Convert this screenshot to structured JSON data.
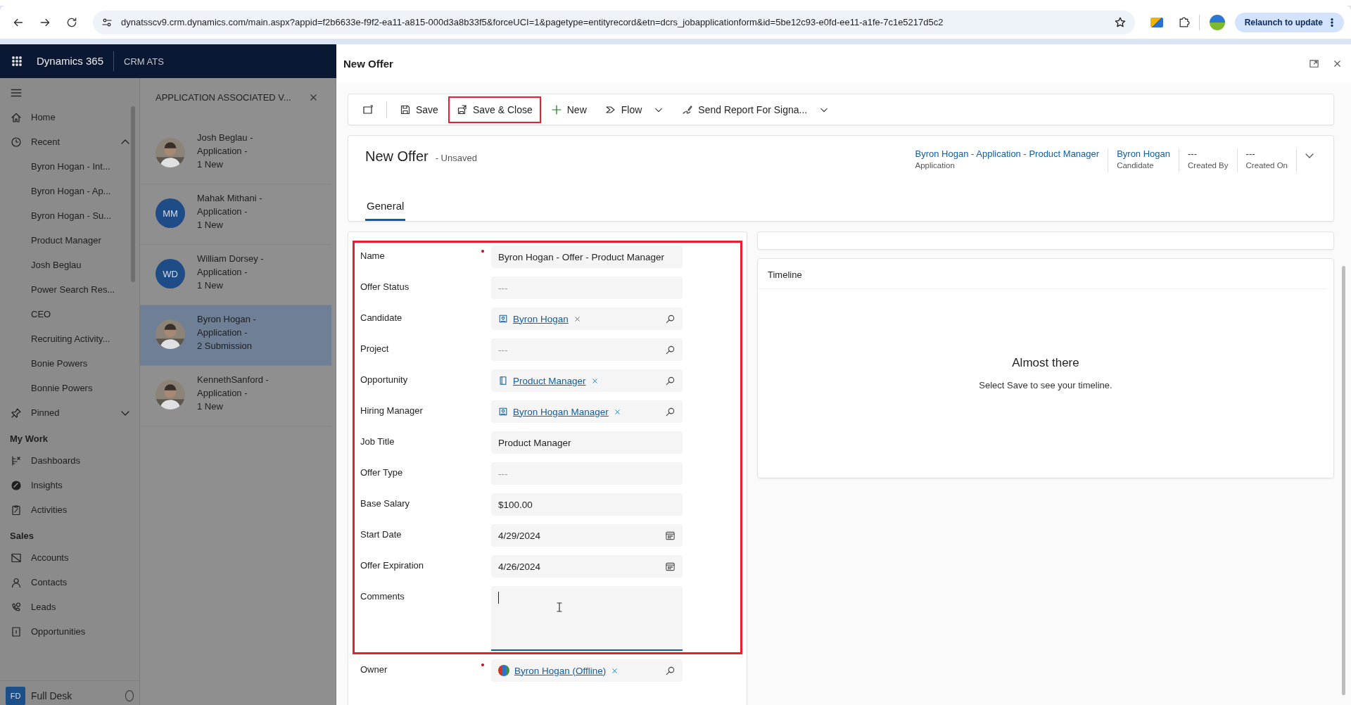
{
  "browser": {
    "url": "dynatsscv9.crm.dynamics.com/main.aspx?appid=f2b6633e-f9f2-ea11-a815-000d3a8b33f5&forceUCI=1&pagetype=entityrecord&etn=dcrs_jobapplicationform&id=5be12c93-e0fd-ee11-a1fe-7c1e5217d5c2",
    "update_button": "Relaunch to update"
  },
  "app": {
    "name": "Dynamics 365",
    "area": "CRM ATS"
  },
  "sidebar": {
    "home": {
      "label": "Home"
    },
    "recent": {
      "label": "Recent",
      "expanded": true,
      "items": [
        "Byron Hogan - Int...",
        "Byron Hogan - Ap...",
        "Byron Hogan - Su...",
        "Product Manager",
        "Josh Beglau",
        "Power Search Res...",
        "CEO",
        "Recruiting Activity...",
        "Bonie Powers",
        "Bonnie Powers"
      ]
    },
    "pinned": {
      "label": "Pinned",
      "expanded": false
    },
    "sections": [
      {
        "title": "My Work",
        "items": [
          "Dashboards",
          "Insights",
          "Activities"
        ]
      },
      {
        "title": "Sales",
        "items": [
          "Accounts",
          "Contacts",
          "Leads",
          "Opportunities"
        ]
      }
    ],
    "footer": {
      "initials": "FD",
      "label": "Full Desk"
    }
  },
  "records": {
    "title": "APPLICATION ASSOCIATED V...",
    "items": [
      {
        "lines": [
          "Josh Beglau -",
          "Application -",
          "1 New"
        ],
        "avatar": {
          "kind": "picture"
        },
        "selected": false
      },
      {
        "lines": [
          "Mahak Mithani -",
          "Application -",
          "1 New"
        ],
        "avatar": {
          "kind": "initials",
          "initials": "MM"
        },
        "selected": false
      },
      {
        "lines": [
          "William Dorsey -",
          "Application -",
          "1 New"
        ],
        "avatar": {
          "kind": "initials",
          "initials": "WD"
        },
        "selected": false
      },
      {
        "lines": [
          "Byron Hogan -",
          "Application -",
          "2 Submission"
        ],
        "avatar": {
          "kind": "picture"
        },
        "selected": true
      },
      {
        "lines": [
          "KennethSanford -",
          "Application -",
          "1 New"
        ],
        "avatar": {
          "kind": "picture"
        },
        "selected": false
      }
    ]
  },
  "dialog": {
    "title": "New Offer",
    "toolbar": [
      {
        "kind": "icon",
        "highlighted": false
      },
      {
        "kind": "button",
        "label": "Save",
        "highlighted": false,
        "dropdown": false
      },
      {
        "kind": "button",
        "label": "Save & Close",
        "highlighted": true,
        "dropdown": false
      },
      {
        "kind": "button",
        "label": "New",
        "highlighted": false,
        "dropdown": false
      },
      {
        "kind": "button",
        "label": "Flow",
        "highlighted": false,
        "dropdown": true
      },
      {
        "kind": "button",
        "label": "Send Report For Signa...",
        "highlighted": false,
        "dropdown": true
      }
    ],
    "header": {
      "title": "New Offer",
      "status": "- Unsaved",
      "fields": [
        {
          "value": "Byron Hogan - Application - Product Manager",
          "label": "Application",
          "link": true
        },
        {
          "value": "Byron Hogan",
          "label": "Candidate",
          "link": true
        },
        {
          "value": "---",
          "label": "Created By",
          "link": false
        },
        {
          "value": "---",
          "label": "Created On",
          "link": false
        }
      ]
    },
    "tabs": [
      {
        "label": "General",
        "selected": true
      }
    ],
    "form": {
      "sections": [
        {
          "highlighted": true,
          "fields": [
            {
              "label": "Name",
              "required": true,
              "kind": "text",
              "value": "Byron Hogan - Offer - Product Manager"
            },
            {
              "label": "Offer Status",
              "required": false,
              "kind": "option",
              "placeholder": "---"
            },
            {
              "label": "Candidate",
              "required": false,
              "kind": "lookup",
              "value": "Byron Hogan"
            },
            {
              "label": "Project",
              "required": false,
              "kind": "lookup",
              "placeholder": "---"
            },
            {
              "label": "Opportunity",
              "required": false,
              "kind": "lookup",
              "value": "Product Manager"
            },
            {
              "label": "Hiring Manager",
              "required": false,
              "kind": "lookup",
              "value": "Byron Hogan Manager"
            },
            {
              "label": "Job Title",
              "required": false,
              "kind": "text",
              "value": "Product Manager"
            },
            {
              "label": "Offer Type",
              "required": false,
              "kind": "option",
              "placeholder": "---"
            },
            {
              "label": "Base Salary",
              "required": false,
              "kind": "text",
              "value": "$100.00"
            },
            {
              "label": "Start Date",
              "required": false,
              "kind": "date",
              "value": "4/29/2024"
            },
            {
              "label": "Offer Expiration",
              "required": false,
              "kind": "date",
              "value": "4/26/2024"
            },
            {
              "label": "Comments",
              "required": false,
              "kind": "textarea",
              "focused": true
            }
          ]
        },
        {
          "highlighted": false,
          "fields": [
            {
              "label": "Owner",
              "required": true,
              "kind": "lookup",
              "value": "Byron Hogan (Offline)"
            }
          ]
        }
      ]
    },
    "timeline": {
      "title": "Timeline",
      "heading": "Almost there",
      "message": "Select Save to see your timeline."
    }
  }
}
